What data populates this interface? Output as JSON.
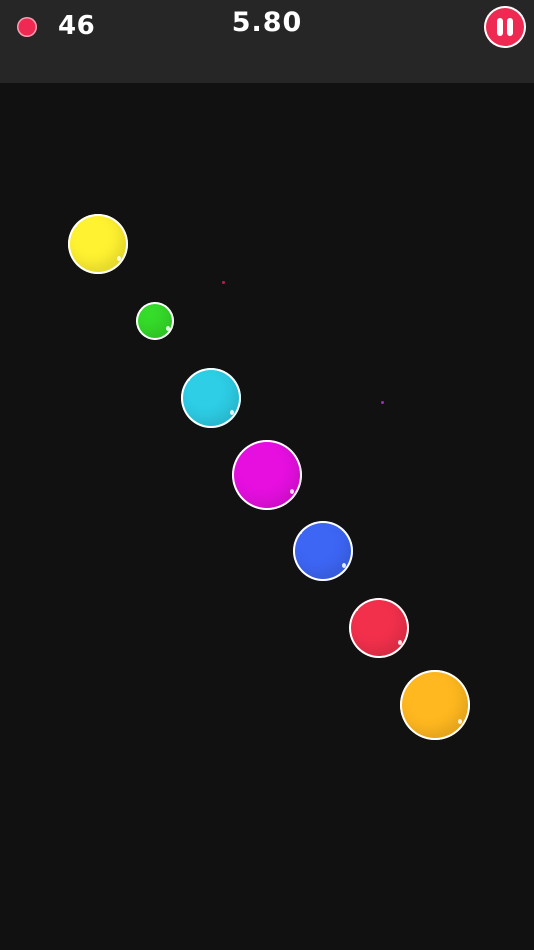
{
  "hud": {
    "score": "46",
    "timer": "5.80",
    "score_dot_color": "#ee2a52",
    "pause_icon": "pause-icon"
  },
  "bubbles": [
    {
      "color": "#fff231",
      "name": "yellow"
    },
    {
      "color": "#35dc2a",
      "name": "green"
    },
    {
      "color": "#2dcee6",
      "name": "cyan"
    },
    {
      "color": "#e60fe0",
      "name": "magenta"
    },
    {
      "color": "#3d66f5",
      "name": "blue"
    },
    {
      "color": "#f2304c",
      "name": "red"
    },
    {
      "color": "#ffb81f",
      "name": "orange"
    }
  ],
  "sparks": [
    {
      "color": "#b0204e"
    },
    {
      "color": "#9a2fb3"
    }
  ]
}
